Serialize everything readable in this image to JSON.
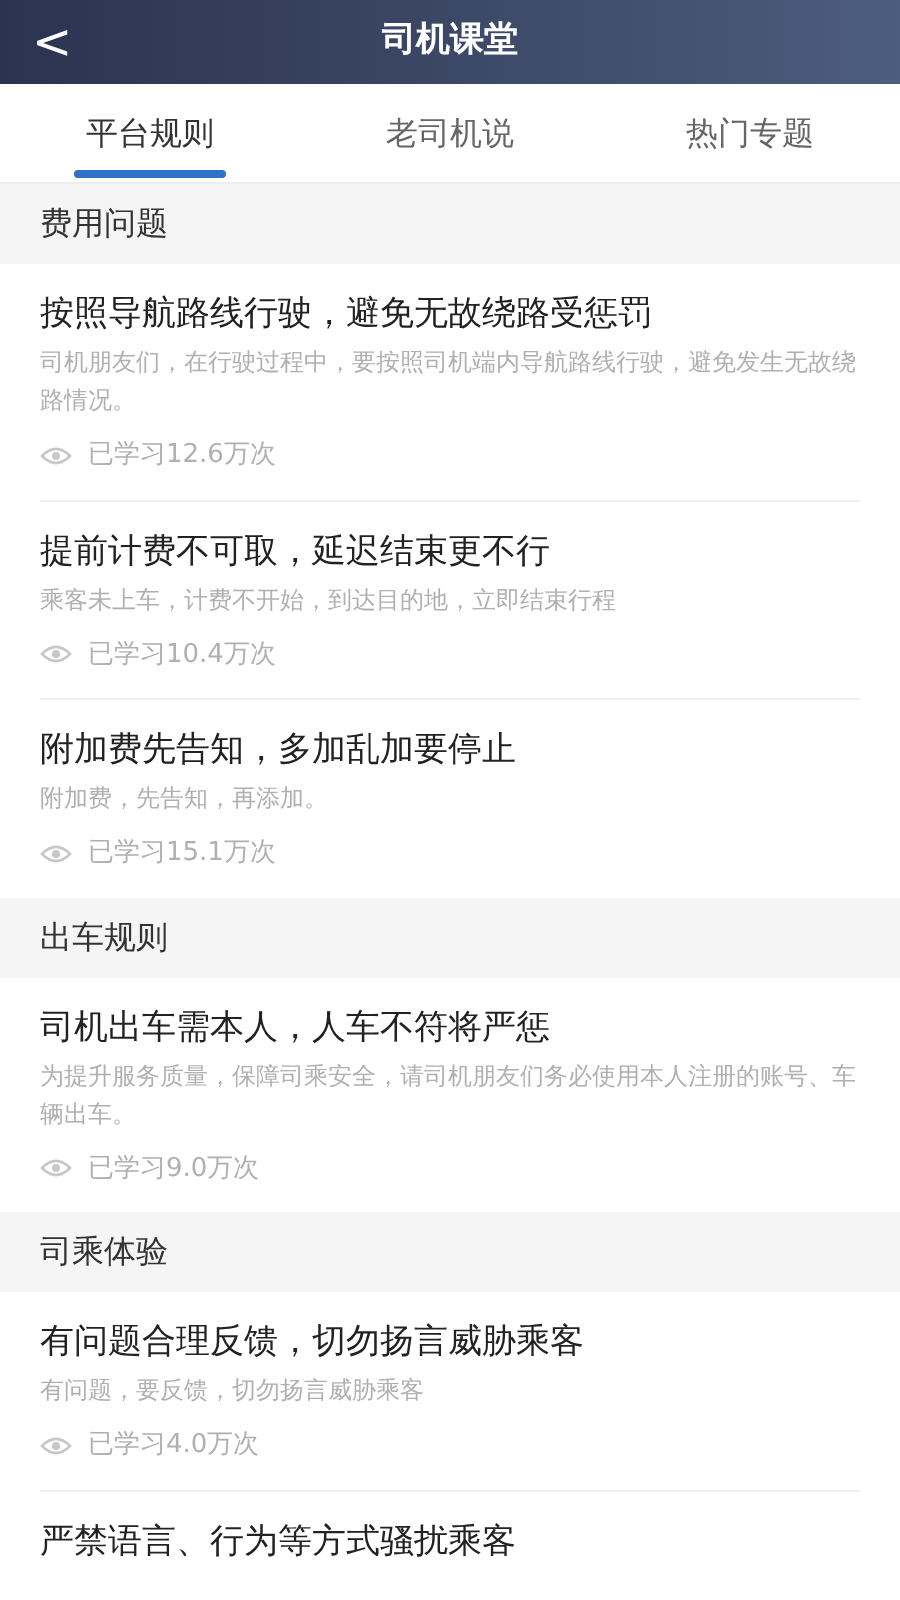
{
  "header": {
    "back": "<",
    "title": "司机课堂"
  },
  "tabs": [
    {
      "label": "平台规则",
      "selected": true
    },
    {
      "label": "老司机说",
      "selected": false
    },
    {
      "label": "热门专题",
      "selected": false
    }
  ],
  "sections": [
    {
      "title": "费用问题",
      "items": [
        {
          "title": "按照导航路线行驶，避免无故绕路受惩罚",
          "desc": "司机朋友们，在行驶过程中，要按照司机端内导航路线行驶，避免发生无故绕路情况。",
          "views": "已学习12.6万次"
        },
        {
          "title": "提前计费不可取，延迟结束更不行",
          "desc": "乘客未上车，计费不开始，到达目的地，立即结束行程",
          "views": "已学习10.4万次"
        },
        {
          "title": "附加费先告知，多加乱加要停止",
          "desc": "附加费，先告知，再添加。",
          "views": "已学习15.1万次"
        }
      ]
    },
    {
      "title": "出车规则",
      "items": [
        {
          "title": "司机出车需本人，人车不符将严惩",
          "desc": "为提升服务质量，保障司乘安全，请司机朋友们务必使用本人注册的账号、车辆出车。",
          "views": "已学习9.0万次"
        }
      ]
    },
    {
      "title": "司乘体验",
      "items": [
        {
          "title": "有问题合理反馈，切勿扬言威胁乘客",
          "desc": "有问题，要反馈，切勿扬言威胁乘客",
          "views": "已学习4.0万次"
        },
        {
          "title": "严禁语言、行为等方式骚扰乘客"
        }
      ]
    }
  ]
}
